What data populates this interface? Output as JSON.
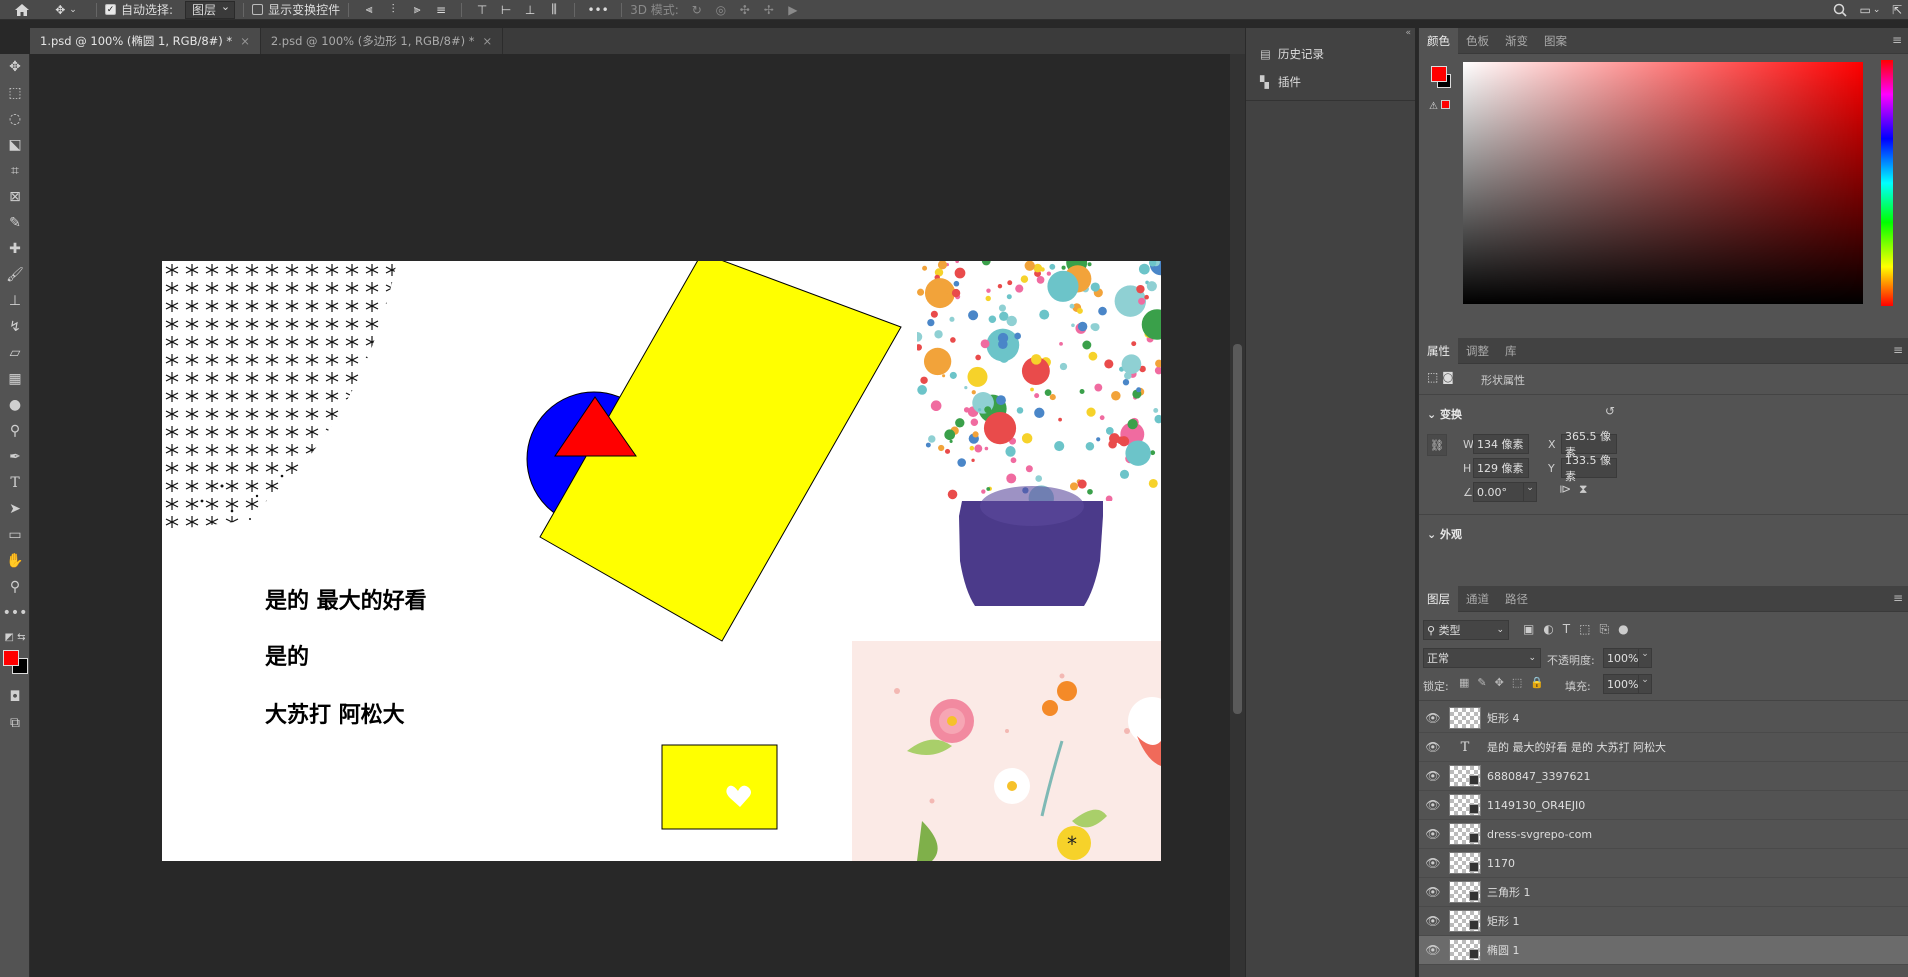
{
  "options_bar": {
    "auto_select_label": "自动选择:",
    "auto_select_value": "图层",
    "show_transform_label": "显示变换控件",
    "mode_3d_label": "3D 模式:",
    "more": "•••"
  },
  "tabs": [
    {
      "label": "1.psd @ 100% (椭圆 1, RGB/8#) *",
      "close": "×"
    },
    {
      "label": "2.psd @ 100% (多边形 1, RGB/8#) *",
      "close": "×"
    }
  ],
  "canvas_text": {
    "line1": "是的 最大的好看",
    "line2": "是的",
    "line3": "大苏打   阿松大"
  },
  "mid_panel": {
    "history": "历史记录",
    "plugins": "插件"
  },
  "color_panel": {
    "tabs": [
      "颜色",
      "色板",
      "渐变",
      "图案"
    ],
    "foreground": "#ff0000",
    "background": "#000000"
  },
  "properties_panel": {
    "tabs": [
      "属性",
      "调整",
      "库"
    ],
    "kind": "形状属性",
    "transform_title": "变换",
    "w_label": "W",
    "w_value": "134 像素",
    "h_label": "H",
    "h_value": "129 像素",
    "x_label": "X",
    "x_value": "365.5 像素",
    "y_label": "Y",
    "y_value": "133.5 像素",
    "angle_value": "0.00°",
    "appearance_title": "外观"
  },
  "layers_panel": {
    "tabs": [
      "图层",
      "通道",
      "路径"
    ],
    "filter_kind": "类型",
    "blend_mode": "正常",
    "opacity_label": "不透明度:",
    "opacity_value": "100%",
    "lock_label": "锁定:",
    "fill_label": "填充:",
    "fill_value": "100%",
    "layers": [
      {
        "name": "矩形 4",
        "type": "pixel"
      },
      {
        "name": "是的 最大的好看  是的  大苏打   阿松大",
        "type": "text"
      },
      {
        "name": "6880847_3397621",
        "type": "smart"
      },
      {
        "name": "1149130_OR4EJI0",
        "type": "smart"
      },
      {
        "name": "dress-svgrepo-com",
        "type": "smart"
      },
      {
        "name": "1170",
        "type": "smart"
      },
      {
        "name": "三角形 1",
        "type": "shape"
      },
      {
        "name": "矩形 1",
        "type": "shape"
      },
      {
        "name": "椭圆 1",
        "type": "shape",
        "selected": true
      }
    ]
  }
}
